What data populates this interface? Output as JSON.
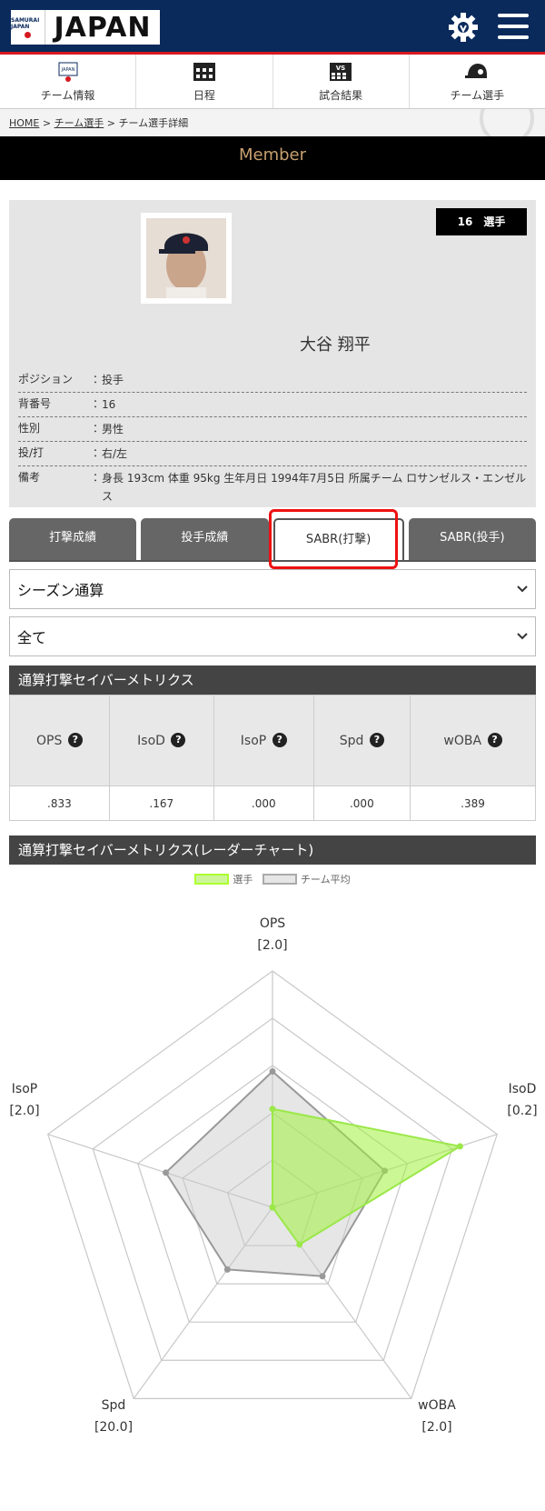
{
  "header": {
    "logo_small": "SAMURAI JAPAN",
    "logo_text": "JAPAN"
  },
  "nav": [
    {
      "label": "チーム情報",
      "icon": "team-logo-icon"
    },
    {
      "label": "日程",
      "icon": "calendar-icon"
    },
    {
      "label": "試合結果",
      "icon": "vs-scoreboard-icon"
    },
    {
      "label": "チーム選手",
      "icon": "helmet-icon"
    }
  ],
  "breadcrumb": {
    "home": "HOME",
    "sep1": ">",
    "players": "チーム選手",
    "sep2": ">",
    "current": "チーム選手詳細"
  },
  "member_title": "Member",
  "player": {
    "number_badge": "16　選手",
    "name": "大谷 翔平",
    "info": [
      {
        "label": "ポジション",
        "sep": "：",
        "value": "投手"
      },
      {
        "label": "背番号",
        "sep": "：",
        "value": "16"
      },
      {
        "label": "性別",
        "sep": "：",
        "value": "男性"
      },
      {
        "label": "投/打",
        "sep": "：",
        "value": "右/左"
      },
      {
        "label": "備考",
        "sep": "：",
        "value": "身長 193cm 体重 95kg 生年月日 1994年7月5日 所属チーム ロサンゼルス・エンゼルス"
      }
    ]
  },
  "tabs": [
    "打撃成績",
    "投手成績",
    "SABR(打撃)",
    "SABR(投手)"
  ],
  "selects": {
    "season": "シーズン通算",
    "filter": "全て"
  },
  "stats_section": {
    "title": "通算打撃セイバーメトリクス",
    "headers": [
      "OPS",
      "IsoD",
      "IsoP",
      "Spd",
      "wOBA"
    ],
    "values": [
      ".833",
      ".167",
      ".000",
      ".000",
      ".389"
    ]
  },
  "radar_section": {
    "title": "通算打撃セイバーメトリクス(レーダーチャート)",
    "legend": [
      "選手",
      "チーム平均"
    ]
  },
  "colors": {
    "header_bg": "#0a2a5c",
    "accent_red": "#d71920",
    "player_series": "#adff2f",
    "avg_series": "#aaaaaa"
  },
  "chart_data": {
    "type": "radar",
    "axes": [
      {
        "label": "OPS",
        "max_label": "[2.0]",
        "max": 2.0
      },
      {
        "label": "IsoD",
        "max_label": "[0.2]",
        "max": 0.2
      },
      {
        "label": "wOBA",
        "max_label": "[2.0]",
        "max": 2.0
      },
      {
        "label": "Spd",
        "max_label": "[20.0]",
        "max": 20.0
      },
      {
        "label": "IsoP",
        "max_label": "[2.0]",
        "max": 2.0
      }
    ],
    "series": [
      {
        "name": "選手",
        "values": [
          0.833,
          0.167,
          0.389,
          0.0,
          0.0
        ]
      },
      {
        "name": "チーム平均",
        "values": [
          1.15,
          0.1,
          0.72,
          6.5,
          0.95
        ]
      }
    ],
    "rings": 5
  }
}
